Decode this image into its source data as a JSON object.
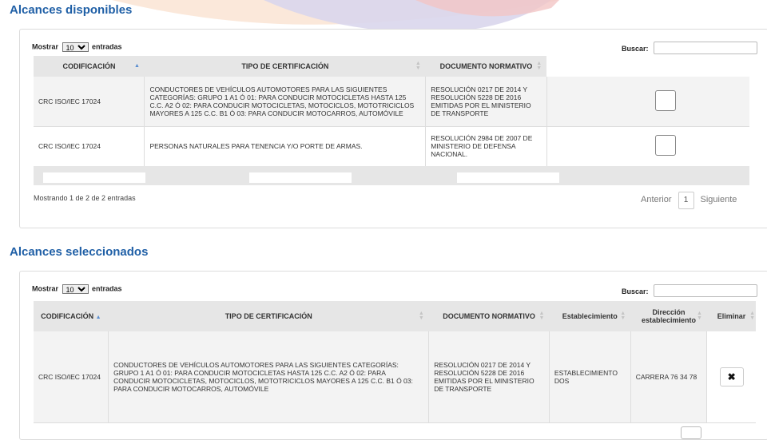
{
  "sections": {
    "available_title": "Alcances disponibles",
    "selected_title": "Alcances seleccionados"
  },
  "available": {
    "show_label": "Mostrar",
    "entries_label": "entradas",
    "page_size": "10",
    "search_label": "Buscar:",
    "columns": [
      "CODIFICACIÓN",
      "TIPO DE CERTIFICACIÓN",
      "DOCUMENTO NORMATIVO"
    ],
    "rows": [
      {
        "code": "CRC ISO/IEC 17024",
        "type": "CONDUCTORES DE VEHÍCULOS AUTOMOTORES PARA LAS SIGUIENTES CATEGORÍAS: GRUPO 1 A1 Ó 01: PARA CONDUCIR MOTOCICLETAS HASTA 125 C.C. A2 Ó 02: PARA CONDUCIR MOTOCICLETAS, MOTOCICLOS, MOTOTRICICLOS MAYORES A 125 C.C. B1 Ó 03: PARA CONDUCIR MOTOCARROS, AUTOMÓVILE",
        "doc": "RESOLUCIÓN 0217 DE 2014 Y RESOLUCIÓN 5228 DE 2016 EMITIDAS POR EL MINISTERIO DE TRANSPORTE"
      },
      {
        "code": "CRC ISO/IEC 17024",
        "type": "PERSONAS NATURALES PARA TENENCIA Y/O PORTE DE ARMAS.",
        "doc": "RESOLUCIÓN 2984 DE 2007 DE MINISTERIO DE DEFENSA NACIONAL."
      }
    ],
    "info": "Mostrando 1 de 2 de 2 entradas",
    "prev": "Anterior",
    "page": "1",
    "next": "Siguiente"
  },
  "selected": {
    "show_label": "Mostrar",
    "entries_label": "entradas",
    "page_size": "10",
    "search_label": "Buscar:",
    "columns": [
      "CODIFICACIÓN",
      "TIPO DE CERTIFICACIÓN",
      "DOCUMENTO NORMATIVO",
      "Establecimiento",
      "Dirección establecimiento",
      "Eliminar"
    ],
    "rows": [
      {
        "code": "CRC ISO/IEC 17024",
        "type": "CONDUCTORES DE VEHÍCULOS AUTOMOTORES PARA LAS SIGUIENTES CATEGORÍAS: GRUPO 1 A1 Ó 01: PARA CONDUCIR MOTOCICLETAS HASTA 125 C.C. A2 Ó 02: PARA CONDUCIR MOTOCICLETAS, MOTOCICLOS, MOTOTRICICLOS MAYORES A 125 C.C. B1 Ó 03: PARA CONDUCIR MOTOCARROS, AUTOMÓVILE",
        "doc": "RESOLUCIÓN 0217 DE 2014 Y RESOLUCIÓN 5228 DE 2016 EMITIDAS POR EL MINISTERIO DE TRANSPORTE",
        "establishment": "ESTABLECIMIENTO DOS",
        "address": "CARRERA 76 34 78",
        "delete": "✖"
      }
    ]
  }
}
